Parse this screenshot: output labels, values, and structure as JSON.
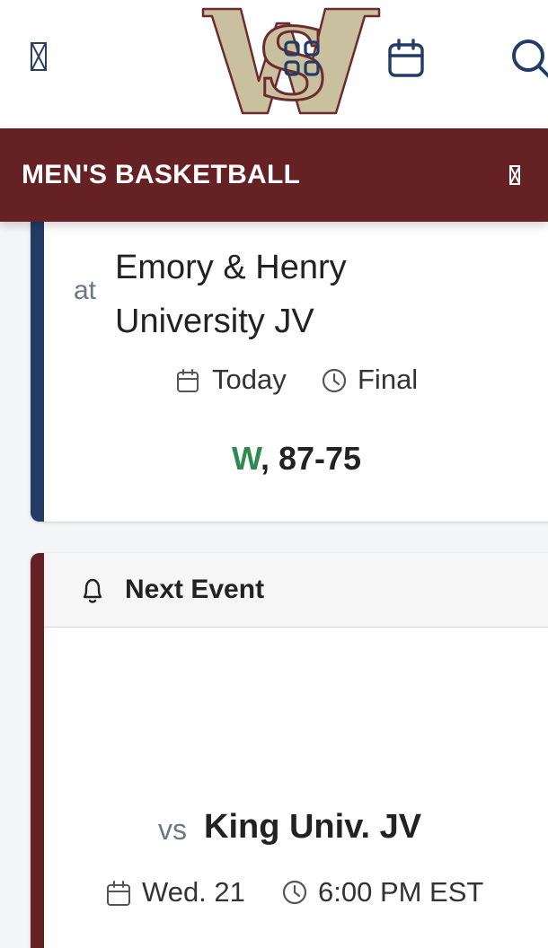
{
  "header": {
    "logo_text": "WS",
    "icons": [
      "menu-icon",
      "apps-icon",
      "calendar-icon",
      "search-icon"
    ]
  },
  "sport_bar": {
    "title": "MEN'S BASKETBALL"
  },
  "previous_event": {
    "prefix": "at",
    "opponent_line1": "Emory & Henry",
    "opponent_line2": "University JV",
    "date": "Today",
    "status": "Final",
    "result_letter": "W",
    "result_score": ", 87-75"
  },
  "next_event": {
    "heading": "Next Event",
    "prefix": "vs",
    "opponent": "King Univ. JV",
    "date": "Wed. 21",
    "time": "6:00 PM EST"
  },
  "colors": {
    "maroon": "#652123",
    "navy": "#233c65",
    "win_green": "#2e8a4f",
    "logo_tan": "#c9c0a0"
  }
}
